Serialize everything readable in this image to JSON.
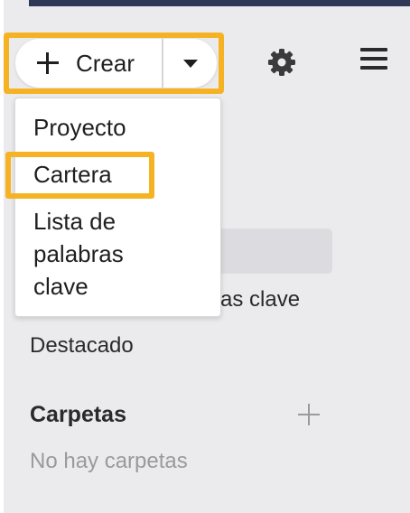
{
  "create_button": {
    "label": "Crear"
  },
  "dropdown": {
    "items": [
      {
        "label": "Proyecto"
      },
      {
        "label": "Cartera"
      },
      {
        "label": "Lista de"
      },
      {
        "label": "palabras"
      },
      {
        "label": "clave"
      }
    ]
  },
  "sidebar": {
    "partial_item": "as clave",
    "featured": "Destacado",
    "folders_title": "Carpetas",
    "folders_empty": "No hay carpetas"
  },
  "colors": {
    "highlight": "#f5b324",
    "topbar": "#2f3957",
    "sidebar_bg": "#ebebee"
  },
  "icons": [
    "plus-icon",
    "chevron-down-icon",
    "gear-icon",
    "hamburger-menu-icon",
    "add-folder-icon"
  ]
}
